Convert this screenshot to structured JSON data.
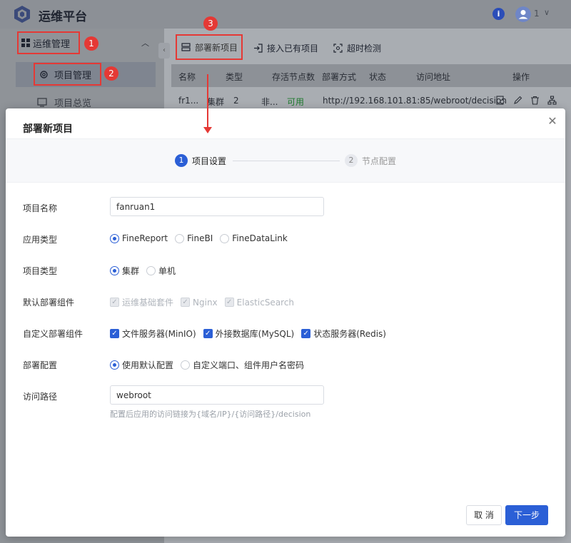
{
  "app": {
    "title": "运维平台",
    "user_count": "1"
  },
  "sidebar": {
    "group_label": "运维管理",
    "item_active_label": "项目管理",
    "item2_label": "项目总览"
  },
  "badges": {
    "b1": "1",
    "b2": "2",
    "b3": "3"
  },
  "toolbar": {
    "deploy_label": "部署新项目",
    "connect_label": "接入已有项目",
    "timeout_label": "超时检测"
  },
  "table": {
    "headers": [
      "名称",
      "类型",
      "存活节点数",
      "部署方式",
      "状态",
      "访问地址",
      "操作"
    ],
    "row": [
      "fr1...",
      "集群",
      "2",
      "非...",
      "可用",
      "http://192.168.101.81:85/webroot/decision"
    ]
  },
  "modal": {
    "title": "部署新项目",
    "steps": [
      {
        "num": "1",
        "label": "项目设置"
      },
      {
        "num": "2",
        "label": "节点配置"
      }
    ],
    "fields": {
      "project_name_label": "项目名称",
      "project_name_value": "fanruan1",
      "app_type_label": "应用类型",
      "app_type_options": [
        "FineReport",
        "FineBI",
        "FineDataLink"
      ],
      "project_type_label": "项目类型",
      "project_type_options": [
        "集群",
        "单机"
      ],
      "default_comp_label": "默认部署组件",
      "default_comp_options": [
        "运维基础套件",
        "Nginx",
        "ElasticSearch"
      ],
      "custom_comp_label": "自定义部署组件",
      "custom_comp_options": [
        "文件服务器(MinIO)",
        "外接数据库(MySQL)",
        "状态服务器(Redis)"
      ],
      "deploy_conf_label": "部署配置",
      "deploy_conf_options": [
        "使用默认配置",
        "自定义端口、组件用户名密码"
      ],
      "access_path_label": "访问路径",
      "access_path_value": "webroot",
      "access_path_hint": "配置后应用的访问链接为{域名/IP}/{访问路径}/decision"
    },
    "cancel_label": "取 消",
    "next_label": "下一步"
  },
  "colors": {
    "accent": "#2b5fd6",
    "annotation": "#e53935",
    "success": "#1e7a2e"
  }
}
